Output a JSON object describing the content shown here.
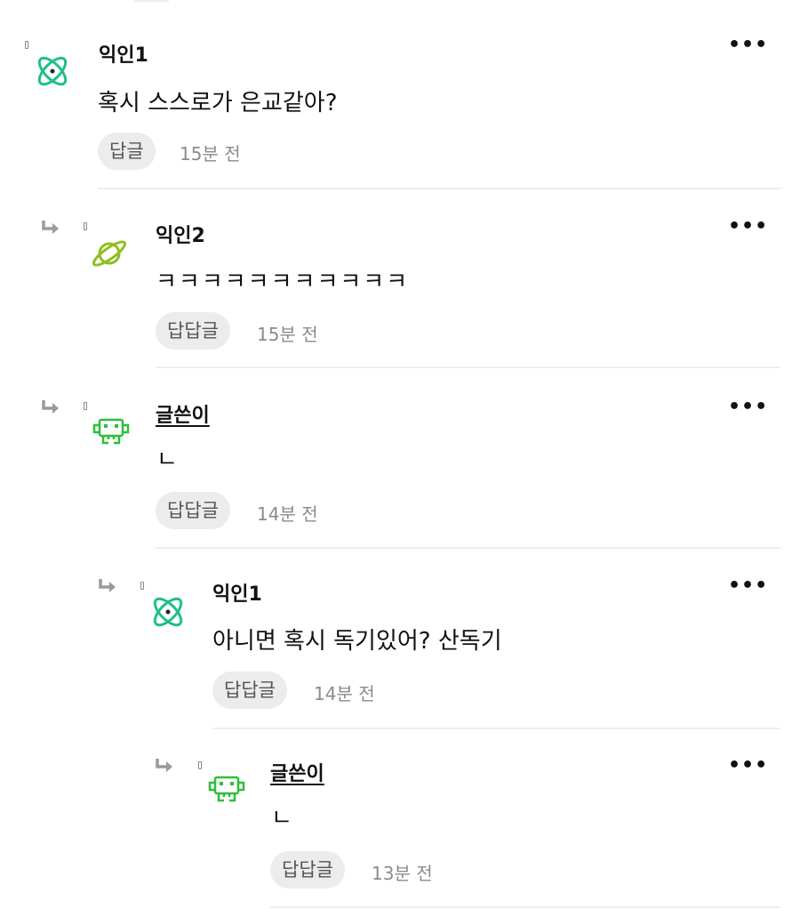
{
  "more_label": "•••",
  "comments": [
    {
      "author": "익인1",
      "text": "혹시 스스로가 은교같아?",
      "reply_label": "답글",
      "time": "15분 전",
      "avatar_icon": "atom-icon",
      "avatar_color": "#1fbf8a"
    },
    {
      "author": "익인2",
      "text": "ㅋㅋㅋㅋㅋㅋㅋㅋㅋㅋㅋ",
      "reply_label": "답답글",
      "time": "15분 전",
      "avatar_icon": "planet-icon",
      "avatar_color": "#8fbf1f"
    },
    {
      "author": "글쓴이",
      "text": "ㄴ",
      "reply_label": "답답글",
      "time": "14분 전",
      "avatar_icon": "space-invader-icon",
      "avatar_color": "#2fbf3a"
    },
    {
      "author": "익인1",
      "text": "아니면 혹시 독기있어? 산독기",
      "reply_label": "답답글",
      "time": "14분 전",
      "avatar_icon": "atom-icon",
      "avatar_color": "#1fbf8a"
    },
    {
      "author": "글쓴이",
      "text": "ㄴ",
      "reply_label": "답답글",
      "time": "13분 전",
      "avatar_icon": "space-invader-icon",
      "avatar_color": "#2fbf3a"
    }
  ]
}
